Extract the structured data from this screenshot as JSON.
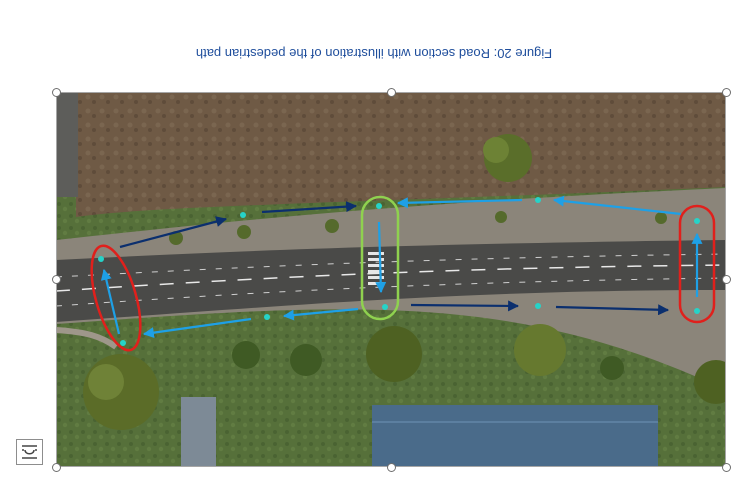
{
  "document": {
    "caption": "Figure 20: Road section with illustration of the pedestrian path"
  },
  "selection": {
    "layout_options_icon": "layout-options-icon",
    "handle_icon": "resize-handle"
  },
  "colors": {
    "grass": "#4f6b35",
    "road": "#4a4a48",
    "sidewalk": "#8b857a",
    "light_arrow": "#1ea0e6",
    "dark_arrow": "#0b2f6e",
    "red_marker": "#e0201c",
    "green_marker": "#8fd14f",
    "roof": "#4a6b8a"
  }
}
